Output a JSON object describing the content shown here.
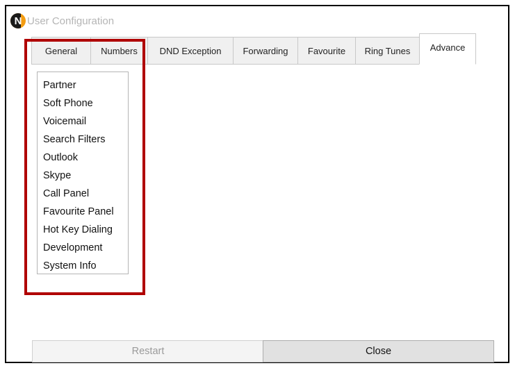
{
  "window": {
    "title": "User Configuration",
    "logo_letter": "N"
  },
  "tabs": [
    {
      "label": "General"
    },
    {
      "label": "Numbers"
    },
    {
      "label": "DND Exception"
    },
    {
      "label": "Forwarding"
    },
    {
      "label": "Favourite"
    },
    {
      "label": "Ring Tunes"
    },
    {
      "label": "Advance",
      "active": true
    }
  ],
  "advance_list": {
    "items": [
      {
        "label": "Partner"
      },
      {
        "label": "Soft Phone"
      },
      {
        "label": "Voicemail"
      },
      {
        "label": "Search Filters"
      },
      {
        "label": "Outlook"
      },
      {
        "label": "Skype"
      },
      {
        "label": "Call Panel"
      },
      {
        "label": "Favourite Panel"
      },
      {
        "label": "Hot Key Dialing"
      },
      {
        "label": "Development"
      },
      {
        "label": "System Info"
      }
    ]
  },
  "buttons": {
    "restart": "Restart",
    "close": "Close"
  },
  "colors": {
    "highlight": "#b00000",
    "logo_orange": "#f39c12",
    "title_text": "#b5b5b5"
  }
}
